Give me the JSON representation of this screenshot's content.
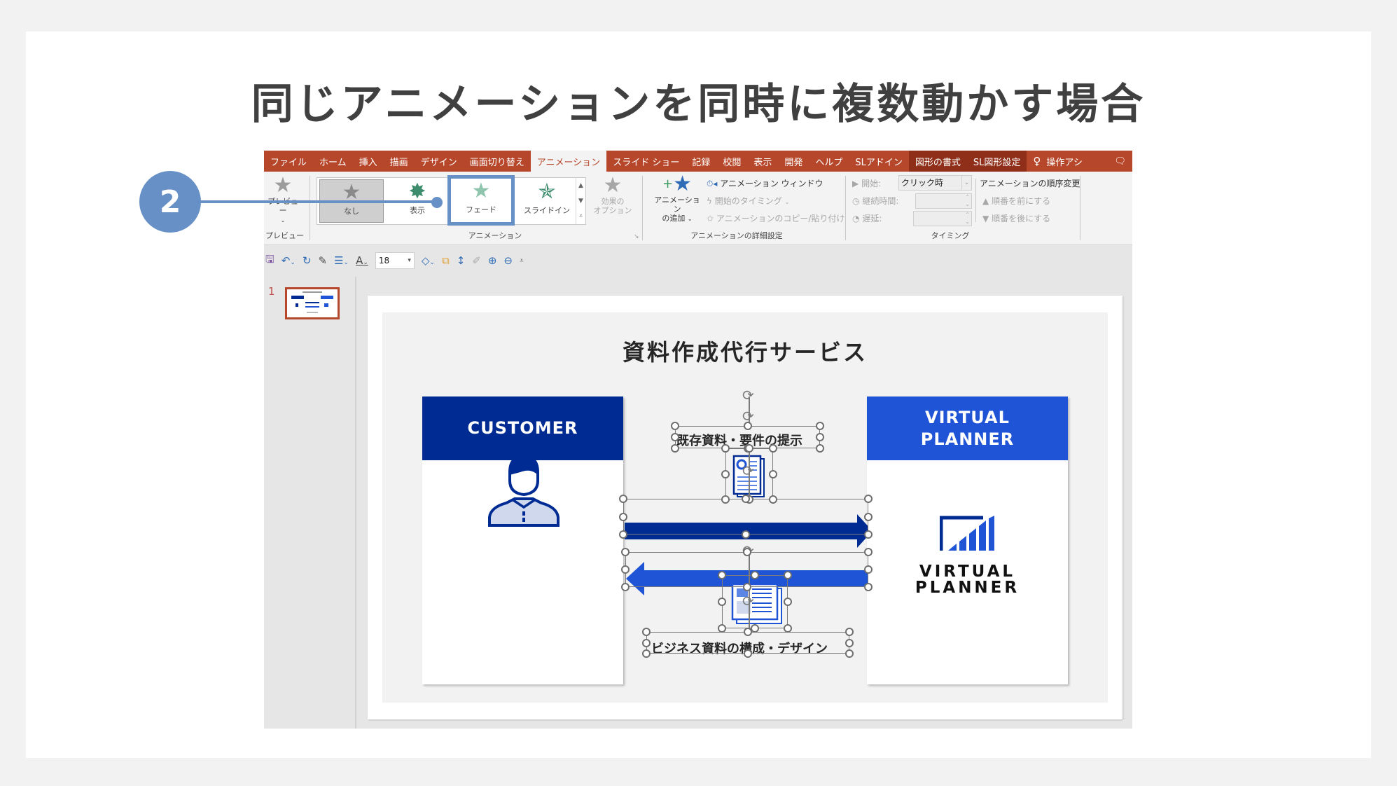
{
  "page": {
    "title": "同じアニメーションを同時に複数動かす場合",
    "step_badge": "2"
  },
  "menubar": {
    "tabs": [
      {
        "label": "ファイル"
      },
      {
        "label": "ホーム"
      },
      {
        "label": "挿入"
      },
      {
        "label": "描画"
      },
      {
        "label": "デザイン"
      },
      {
        "label": "画面切り替え"
      },
      {
        "label": "アニメーション",
        "active": true
      },
      {
        "label": "スライド ショー"
      },
      {
        "label": "記録"
      },
      {
        "label": "校閲"
      },
      {
        "label": "表示"
      },
      {
        "label": "開発"
      },
      {
        "label": "ヘルプ"
      },
      {
        "label": "SLアドイン"
      },
      {
        "label": "図形の書式",
        "contextual": true
      },
      {
        "label": "SL図形設定",
        "contextual": true
      }
    ],
    "tell_me": "操作アシ",
    "tell_me_icon": "lightbulb-icon",
    "comment_icon": "comment-icon"
  },
  "ribbon": {
    "preview": {
      "button_label": "プレビュー",
      "group_label": "プレビュー"
    },
    "animation_gallery": {
      "group_label": "アニメーション",
      "items": [
        {
          "label": "なし",
          "state": "current"
        },
        {
          "label": "表示"
        },
        {
          "label": "フェード",
          "highlighted": true
        },
        {
          "label": "スライドイン"
        }
      ],
      "effect_options_label": "効果の\nオプション"
    },
    "advanced": {
      "group_label": "アニメーションの詳細設定",
      "add_animation_line1": "アニメーション",
      "add_animation_line2": "の追加",
      "animation_pane": "アニメーション ウィンドウ",
      "trigger": "開始のタイミング",
      "painter": "アニメーションのコピー/貼り付け"
    },
    "timing": {
      "group_label": "タイミング",
      "start_label": "開始:",
      "start_value": "クリック時",
      "duration_label": "継続時間:",
      "duration_value": "",
      "delay_label": "遅延:",
      "delay_value": "",
      "reorder_title": "アニメーションの順序変更",
      "move_earlier": "順番を前にする",
      "move_later": "順番を後にする"
    }
  },
  "qat": {
    "font_size": "18"
  },
  "thumbnails": {
    "slide_number": "1"
  },
  "slide": {
    "title": "資料作成代行サービス",
    "customer_header": "CUSTOMER",
    "planner_header_line1": "VIRTUAL",
    "planner_header_line2": "PLANNER",
    "logo_line1": "VIRTUAL",
    "logo_line2": "PLANNER",
    "top_label": "既存資料・要件の提示",
    "bottom_label": "ビジネス資料の構成・デザイン",
    "colors": {
      "customer": "#002b92",
      "planner": "#1f54d6",
      "ribbon_accent": "#b7472a",
      "badge": "#6790c6"
    }
  }
}
